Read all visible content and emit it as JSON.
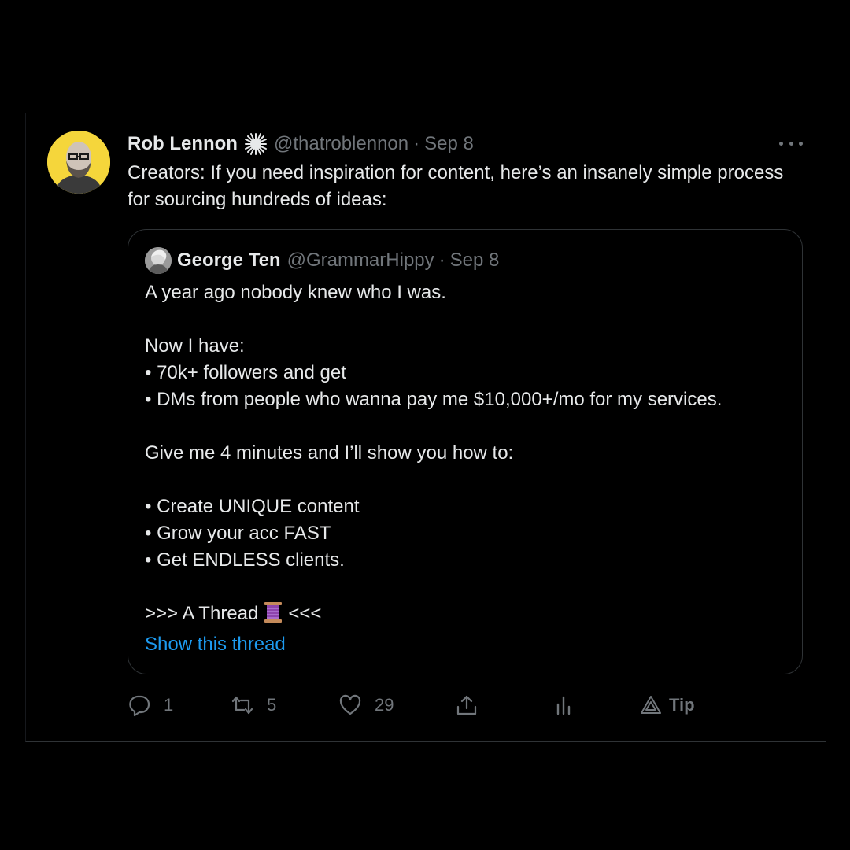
{
  "tweet": {
    "author_name": "Rob Lennon",
    "author_badge_icon": "sparkle-burst-icon",
    "author_handle": "@thatroblennon",
    "separator": "·",
    "date": "Sep 8",
    "text": "Creators: If you need inspiration for content, here’s an insanely simple process for sourcing hundreds of ideas:",
    "more_icon": "more-horizontal-icon"
  },
  "quoted": {
    "author_name": "George Ten",
    "author_handle": "@GrammarHippy",
    "separator": "·",
    "date": "Sep 8",
    "lines": [
      "A year ago nobody knew who I was.",
      "",
      "Now I have:",
      "• 70k+ followers and get",
      "• DMs from people who wanna pay me $10,000+/mo for my services.",
      "",
      "Give me 4 minutes and I’ll show you how to:",
      "",
      "• Create UNIQUE content",
      "• Grow your acc FAST",
      "• Get ENDLESS clients.",
      ""
    ],
    "thread_line_prefix": ">>> A Thread",
    "thread_line_suffix": "<<<",
    "thread_emoji_icon": "thread-spool-icon",
    "show_thread_label": "Show this thread"
  },
  "actions": {
    "reply_count": "1",
    "retweet_count": "5",
    "like_count": "29",
    "tip_label": "Tip"
  },
  "colors": {
    "background": "#000000",
    "text": "#e7e9ea",
    "muted": "#71767b",
    "link": "#1d9bf0",
    "border": "#2f3336",
    "avatar_bg": "#f5d63b"
  }
}
